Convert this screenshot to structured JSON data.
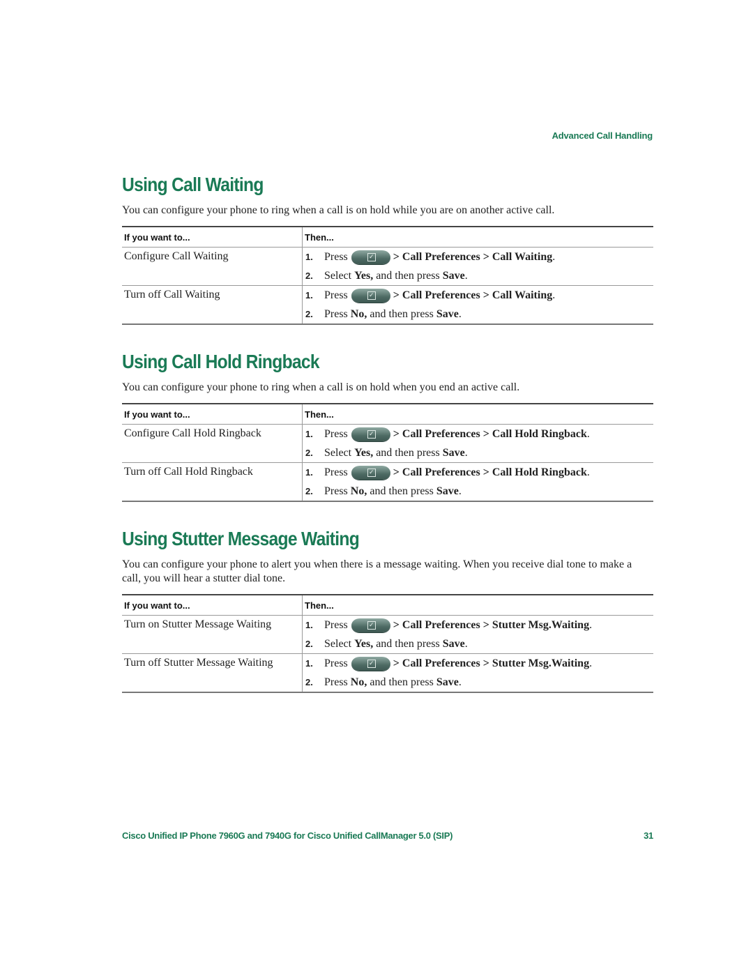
{
  "running_head": "Advanced Call Handling",
  "table_headers": {
    "col1": "If you want to...",
    "col2": "Then..."
  },
  "sections": [
    {
      "title": "Using Call Waiting",
      "intro": "You can configure your phone to ring when a call is on hold while you are on another active call.",
      "rows": [
        {
          "want": "Configure Call Waiting",
          "steps": [
            {
              "num": "1.",
              "pre": "Press",
              "icon": "settings-check-key-icon",
              "path": "> Call Preferences > Call Waiting",
              "end": "."
            },
            {
              "num": "2.",
              "text1": "Select ",
              "bold1": "Yes,",
              "text2": " and then press ",
              "bold2": "Save",
              "end": "."
            }
          ]
        },
        {
          "want": "Turn off Call Waiting",
          "steps": [
            {
              "num": "1.",
              "pre": "Press",
              "icon": "settings-check-key-icon",
              "path": "> Call Preferences > Call Waiting",
              "end": "."
            },
            {
              "num": "2.",
              "text1": "Press ",
              "bold1": "No,",
              "text2": " and then press ",
              "bold2": "Save",
              "end": "."
            }
          ]
        }
      ]
    },
    {
      "title": "Using Call Hold Ringback",
      "intro": "You can configure your phone to ring when a call is on hold when you end an active call.",
      "rows": [
        {
          "want": "Configure Call Hold Ringback",
          "steps": [
            {
              "num": "1.",
              "pre": "Press",
              "icon": "settings-check-key-icon",
              "path": "> Call Preferences > Call Hold Ringback",
              "end": "."
            },
            {
              "num": "2.",
              "text1": "Select ",
              "bold1": "Yes,",
              "text2": " and then press ",
              "bold2": "Save",
              "end": "."
            }
          ]
        },
        {
          "want": "Turn off Call Hold Ringback",
          "steps": [
            {
              "num": "1.",
              "pre": "Press",
              "icon": "settings-check-key-icon",
              "path": "> Call Preferences > Call Hold Ringback",
              "end": "."
            },
            {
              "num": "2.",
              "text1": "Press ",
              "bold1": "No,",
              "text2": " and then press ",
              "bold2": "Save",
              "end": "."
            }
          ]
        }
      ]
    },
    {
      "title": "Using Stutter Message Waiting",
      "intro": "You can configure your phone to alert you when there is a message waiting. When you receive dial tone to make a call, you will hear a stutter dial tone.",
      "rows": [
        {
          "want": "Turn on Stutter Message Waiting",
          "steps": [
            {
              "num": "1.",
              "pre": "Press",
              "icon": "settings-check-key-icon",
              "path": "> Call Preferences > Stutter Msg.Waiting",
              "end": "."
            },
            {
              "num": "2.",
              "text1": "Select ",
              "bold1": "Yes,",
              "text2": " and then press ",
              "bold2": "Save",
              "end": "."
            }
          ]
        },
        {
          "want": "Turn off Stutter Message Waiting",
          "steps": [
            {
              "num": "1.",
              "pre": "Press",
              "icon": "settings-check-key-icon",
              "path": "> Call Preferences > Stutter Msg.Waiting",
              "end": "."
            },
            {
              "num": "2.",
              "text1": "Press ",
              "bold1": "No,",
              "text2": " and then press ",
              "bold2": "Save",
              "end": "."
            }
          ]
        }
      ]
    }
  ],
  "footer": {
    "title": "Cisco Unified IP Phone 7960G and 7940G for Cisco Unified CallManager 5.0 (SIP)",
    "page_number": "31"
  },
  "colors": {
    "accent": "#1a7a55",
    "text": "#222222"
  }
}
